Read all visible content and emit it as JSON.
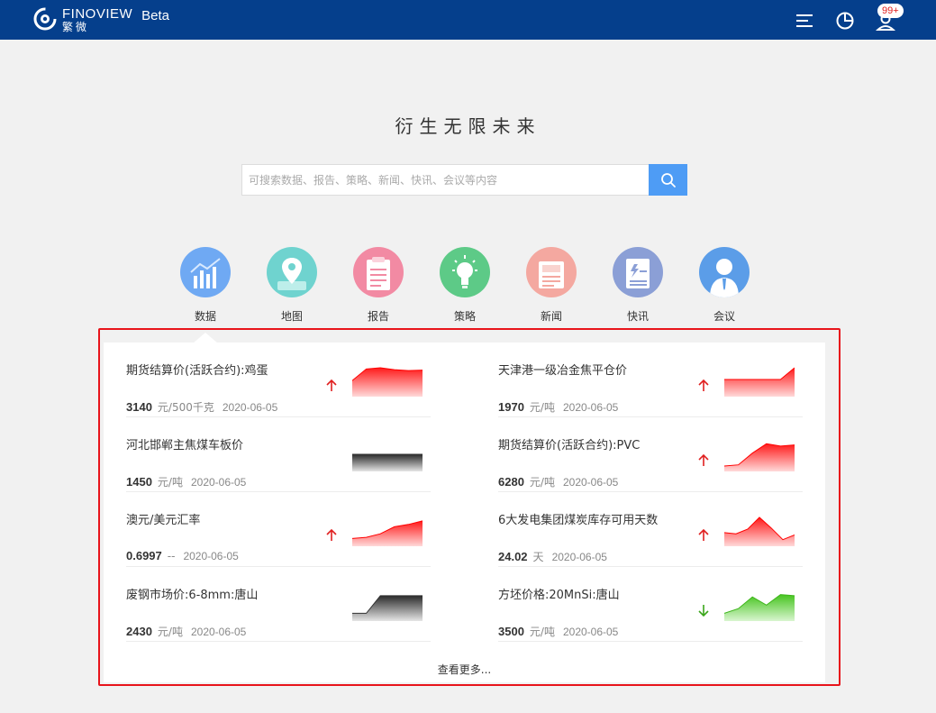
{
  "header": {
    "brand_en": "FINOVIEW",
    "brand_cn": "繁微",
    "beta": "Beta",
    "notifications": "99+"
  },
  "hero": {
    "slogan": "衍生无限未来",
    "search_placeholder": "可搜索数据、报告、策略、新闻、快讯、会议等内容"
  },
  "categories": [
    {
      "label": "数据",
      "icon": "data-chart-icon",
      "color": "#6fa9f3"
    },
    {
      "label": "地图",
      "icon": "map-pin-icon",
      "color": "#6fd3cf"
    },
    {
      "label": "报告",
      "icon": "clipboard-icon",
      "color": "#f28aa3"
    },
    {
      "label": "策略",
      "icon": "lightbulb-icon",
      "color": "#5dca87"
    },
    {
      "label": "新闻",
      "icon": "newspaper-icon",
      "color": "#f4a8a0"
    },
    {
      "label": "快讯",
      "icon": "flash-doc-icon",
      "color": "#8b9fd6"
    },
    {
      "label": "会议",
      "icon": "person-icon",
      "color": "#5b9de8"
    }
  ],
  "items": [
    {
      "title": "期货结算价(活跃合约):鸡蛋",
      "value": "3140",
      "unit": "元/500千克",
      "date": "2020-06-05",
      "trend": "up",
      "spark": [
        0.45,
        0.95,
        1.0,
        0.92,
        0.88,
        0.9
      ],
      "spark_color": "red"
    },
    {
      "title": "天津港一级冶金焦平仓价",
      "value": "1970",
      "unit": "元/吨",
      "date": "2020-06-05",
      "trend": "up",
      "spark": [
        0.5,
        0.5,
        0.5,
        0.5,
        0.5,
        1.0
      ],
      "spark_color": "red"
    },
    {
      "title": "河北邯郸主焦煤车板价",
      "value": "1450",
      "unit": "元/吨",
      "date": "2020-06-05",
      "trend": "none",
      "spark": [
        0.5,
        0.5,
        0.5,
        0.5,
        0.5,
        0.5
      ],
      "spark_color": "gray"
    },
    {
      "title": "期货结算价(活跃合约):PVC",
      "value": "6280",
      "unit": "元/吨",
      "date": "2020-06-05",
      "trend": "up",
      "spark": [
        0.0,
        0.05,
        0.55,
        0.95,
        0.85,
        0.9
      ],
      "spark_color": "red"
    },
    {
      "title": "澳元/美元汇率",
      "value": "0.6997",
      "unit": "--",
      "date": "2020-06-05",
      "trend": "up",
      "spark": [
        0.1,
        0.15,
        0.3,
        0.6,
        0.7,
        0.85
      ],
      "spark_color": "red"
    },
    {
      "title": "6大发电集团煤炭库存可用天数",
      "value": "24.02",
      "unit": "天",
      "date": "2020-06-05",
      "trend": "up",
      "spark": [
        0.35,
        0.3,
        0.5,
        1.0,
        0.55,
        0.05,
        0.25
      ],
      "spark_color": "red"
    },
    {
      "title": "废钢市场价:6-8mm:唐山",
      "value": "2430",
      "unit": "元/吨",
      "date": "2020-06-05",
      "trend": "none",
      "spark": [
        0.1,
        0.1,
        0.85,
        0.85,
        0.85,
        0.85
      ],
      "spark_color": "gray"
    },
    {
      "title": "方坯价格:20MnSi:唐山",
      "value": "3500",
      "unit": "元/吨",
      "date": "2020-06-05",
      "trend": "down",
      "spark": [
        0.1,
        0.3,
        0.8,
        0.45,
        0.9,
        0.85
      ],
      "spark_color": "green"
    }
  ],
  "more_label": "查看更多..."
}
